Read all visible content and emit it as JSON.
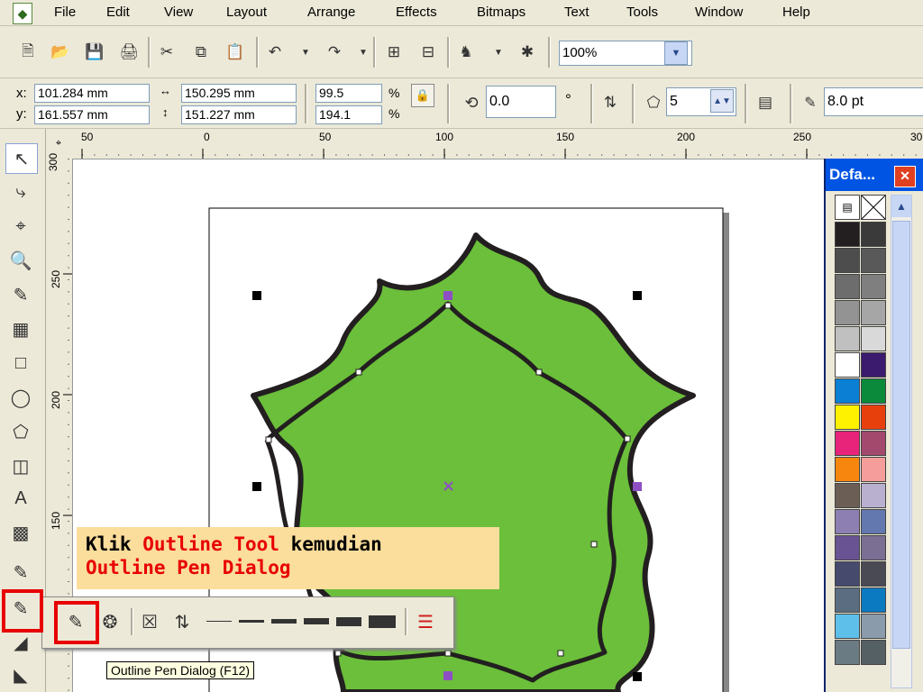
{
  "menu": [
    "File",
    "Edit",
    "View",
    "Layout",
    "Arrange",
    "Effects",
    "Bitmaps",
    "Text",
    "Tools",
    "Window",
    "Help"
  ],
  "toolbar": {
    "zoom_value": "100%"
  },
  "propbar": {
    "x_label": "x:",
    "x_value": "101.284 mm",
    "y_label": "y:",
    "y_value": "161.557 mm",
    "width_value": "150.295 mm",
    "height_value": "151.227 mm",
    "scale_x": "99.5",
    "scale_y": "194.1",
    "percent": "%",
    "rotation": "0.0",
    "degree": "°",
    "sides": "5",
    "outline_width": "8.0 pt"
  },
  "hruler": [
    "50",
    "0",
    "50",
    "100",
    "150",
    "200",
    "250",
    "30"
  ],
  "vruler": [
    "300",
    "250",
    "200",
    "150"
  ],
  "palette": {
    "title": "Defa...",
    "colors": [
      "#231f20",
      "#3a3a3a",
      "#4d4d4d",
      "#595959",
      "#6d6d6d",
      "#7f7f7f",
      "#939393",
      "#a6a6a6",
      "#c0c0c0",
      "#d9d9d9",
      "#ffffff",
      "#3b1b6e",
      "#0a7fd4",
      "#0b8a3c",
      "#fff200",
      "#e8400d",
      "#e8237a",
      "#a3496e",
      "#f7860f",
      "#f59d9a",
      "#6b5f55",
      "#b9b0d0",
      "#8d7fb2",
      "#6278ae",
      "#6a5393",
      "#7b6f94",
      "#464a6d",
      "#4a4a55",
      "#5b6d80",
      "#0c7ac0",
      "#5dbfea",
      "#8a9bab",
      "#6b7b84",
      "#556065"
    ]
  },
  "callout": {
    "part1": "Klik ",
    "part2": "Outline Tool",
    "part3": " kemudian",
    "part4": "Outline Pen Dialog"
  },
  "tooltip": "Outline Pen Dialog (F12)",
  "colors": {
    "shape_fill": "#6bbf3a",
    "outline": "#231f20",
    "highlight": "#e80000",
    "callout_bg": "#fbdd9c",
    "callout_red": "#e80000",
    "selection_handle": "#8e4fc4"
  }
}
